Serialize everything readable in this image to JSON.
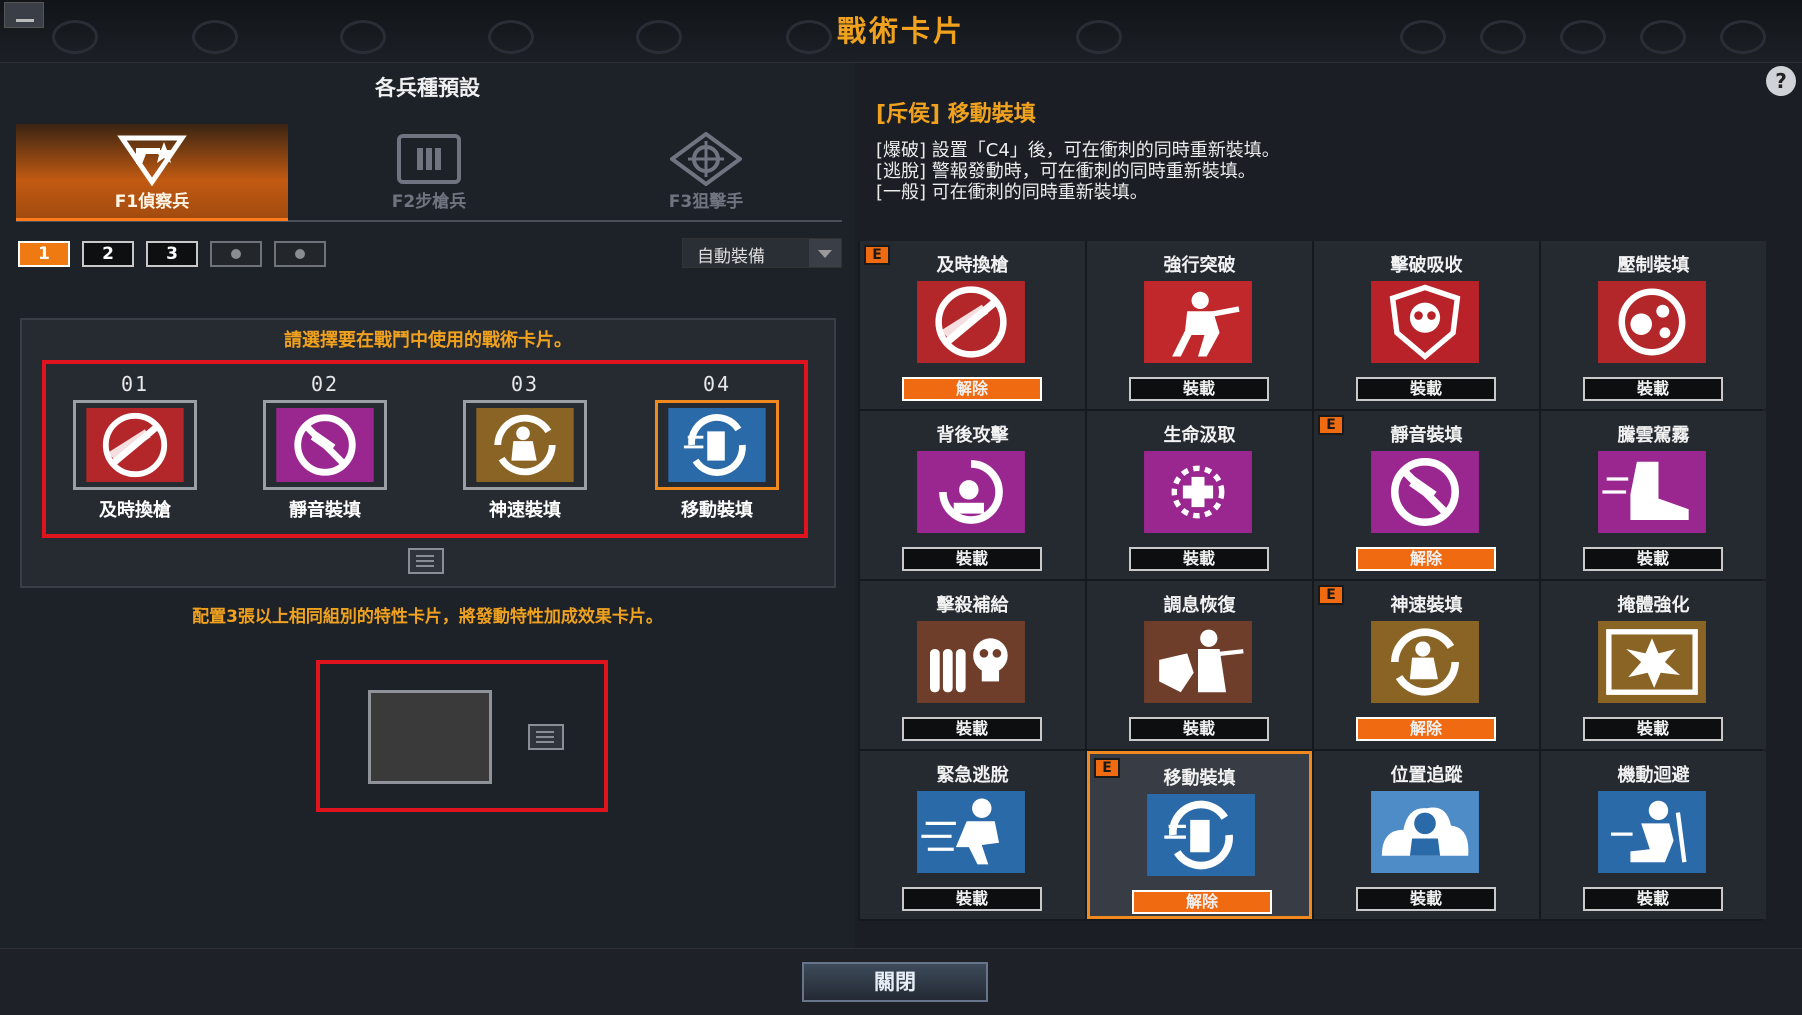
{
  "window": {
    "title": "戰術卡片"
  },
  "left": {
    "section_title": "各兵種預設",
    "class_tabs": [
      {
        "label": "F1偵察兵",
        "active": true,
        "icon": "scout-icon"
      },
      {
        "label": "F2步槍兵",
        "active": false,
        "icon": "rifleman-icon"
      },
      {
        "label": "F3狙擊手",
        "active": false,
        "icon": "sniper-icon"
      }
    ],
    "presets": [
      {
        "label": "1",
        "active": true
      },
      {
        "label": "2",
        "active": false
      },
      {
        "label": "3",
        "active": false
      },
      {
        "label": "",
        "locked": true
      },
      {
        "label": "",
        "locked": true
      }
    ],
    "auto_equip": "自動裝備",
    "frame_hint": "請選擇要在戰鬥中使用的戰術卡片。",
    "slots": [
      {
        "num": "01",
        "label": "及時換槍",
        "icon": "quick-swap-icon",
        "border": "#9a9ea5"
      },
      {
        "num": "02",
        "label": "靜音裝填",
        "icon": "silent-reload-icon",
        "border": "#9a9ea5"
      },
      {
        "num": "03",
        "label": "神速裝填",
        "icon": "speed-reload-icon",
        "border": "#9a9ea5"
      },
      {
        "num": "04",
        "label": "移動裝填",
        "icon": "move-reload-icon",
        "border": "#f08a1e"
      }
    ],
    "bonus_hint": "配置3張以上相同組別的特性卡片，將發動特性加成效果卡片。"
  },
  "detail": {
    "title": "[斥侯] 移動裝填",
    "lines": [
      "[爆破] 設置「C4」後，可在衝刺的同時重新裝填。",
      "[逃脫] 警報發動時，可在衝刺的同時重新裝填。",
      "[一般] 可在衝刺的同時重新裝填。"
    ],
    "help": "?"
  },
  "grid": [
    {
      "name": "及時換槍",
      "icon": "quick-swap-icon",
      "button": "解除",
      "equipped": true,
      "badge": "E"
    },
    {
      "name": "強行突破",
      "icon": "breakthrough-icon",
      "button": "裝載",
      "equipped": false
    },
    {
      "name": "擊破吸收",
      "icon": "kill-absorb-icon",
      "button": "裝載",
      "equipped": false
    },
    {
      "name": "壓制裝填",
      "icon": "suppress-reload-icon",
      "button": "裝載",
      "equipped": false
    },
    {
      "name": "背後攻擊",
      "icon": "back-attack-icon",
      "button": "裝載",
      "equipped": false
    },
    {
      "name": "生命汲取",
      "icon": "life-drain-icon",
      "button": "裝載",
      "equipped": false
    },
    {
      "name": "靜音裝填",
      "icon": "silent-reload-icon",
      "button": "解除",
      "equipped": true,
      "badge": "E"
    },
    {
      "name": "騰雲駕霧",
      "icon": "boot-icon",
      "button": "裝載",
      "equipped": false
    },
    {
      "name": "擊殺補給",
      "icon": "kill-supply-icon",
      "button": "裝載",
      "equipped": false
    },
    {
      "name": "調息恢復",
      "icon": "recovery-icon",
      "button": "裝載",
      "equipped": false
    },
    {
      "name": "神速裝填",
      "icon": "speed-reload-icon",
      "button": "解除",
      "equipped": true,
      "badge": "E"
    },
    {
      "name": "掩體強化",
      "icon": "cover-boost-icon",
      "button": "裝載",
      "equipped": false
    },
    {
      "name": "緊急逃脫",
      "icon": "escape-icon",
      "button": "裝載",
      "equipped": false
    },
    {
      "name": "移動裝填",
      "icon": "move-reload-icon",
      "button": "解除",
      "equipped": true,
      "badge": "E",
      "selected": true
    },
    {
      "name": "位置追蹤",
      "icon": "tracking-icon",
      "button": "裝載",
      "equipped": false
    },
    {
      "name": "機動迴避",
      "icon": "evade-icon",
      "button": "裝載",
      "equipped": false
    }
  ],
  "footer": {
    "close": "關閉"
  },
  "colors": {
    "accent": "#f0a21e",
    "equip_orange": "#f06a12",
    "highlight_red": "#e0141e"
  }
}
